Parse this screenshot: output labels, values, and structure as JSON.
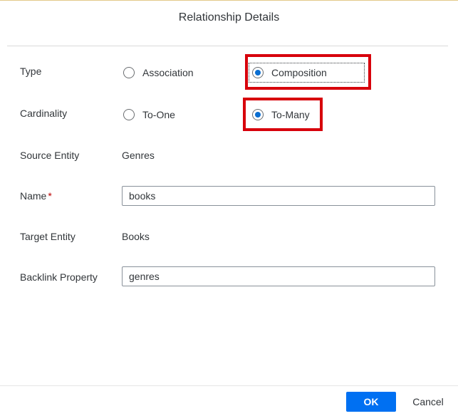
{
  "dialog": {
    "title": "Relationship Details"
  },
  "type": {
    "label": "Type",
    "options": [
      {
        "label": "Association",
        "selected": false
      },
      {
        "label": "Composition",
        "selected": true
      }
    ]
  },
  "cardinality": {
    "label": "Cardinality",
    "options": [
      {
        "label": "To-One",
        "selected": false
      },
      {
        "label": "To-Many",
        "selected": true
      }
    ]
  },
  "source_entity": {
    "label": "Source Entity",
    "value": "Genres"
  },
  "name": {
    "label": "Name",
    "required_marker": "*",
    "value": "books"
  },
  "target_entity": {
    "label": "Target Entity",
    "value": "Books"
  },
  "backlink_property": {
    "label": "Backlink Property",
    "value": "genres"
  },
  "footer": {
    "ok_label": "OK",
    "cancel_label": "Cancel"
  },
  "colors": {
    "primary_button": "#0070f2",
    "radio_selected": "#0a6ed1",
    "required_marker": "#bb0000",
    "highlight_box": "#d7000b"
  }
}
